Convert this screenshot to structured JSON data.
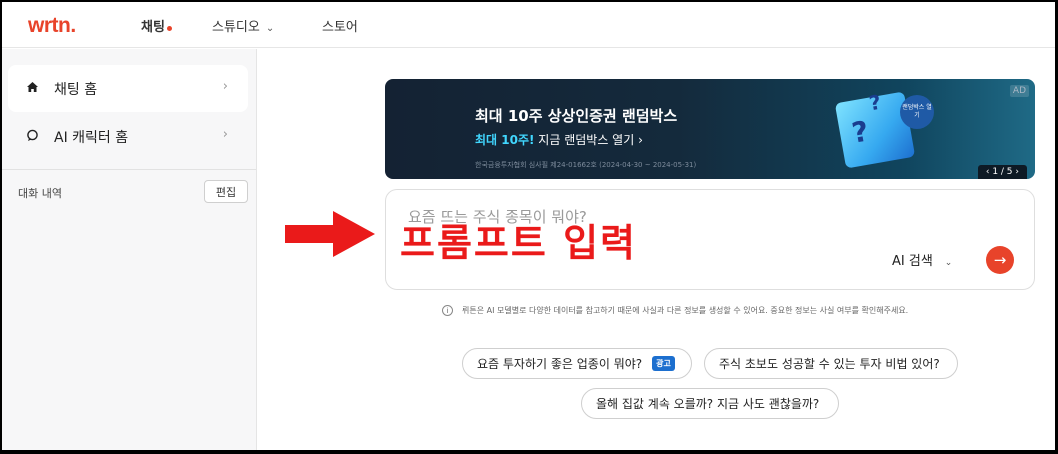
{
  "header": {
    "logo": "wrtn.",
    "nav": [
      {
        "label": "채팅"
      },
      {
        "label": "스튜디오"
      },
      {
        "label": "스토어"
      }
    ]
  },
  "sidebar": {
    "items": [
      {
        "label": "채팅 홈",
        "icon": "home-icon"
      },
      {
        "label": "AI 캐릭터 홈",
        "icon": "chat-bubble-icon"
      }
    ],
    "history_label": "대화 내역",
    "edit_label": "편집"
  },
  "ad_banner": {
    "title": "최대 10주 상상인증권 랜덤박스",
    "sub_highlight": "최대 10주!",
    "sub_rest": " 지금 랜덤박스 열기 ›",
    "fine_print": "한국금융투자협회 심사필 제24-01662호 (2024-04-30 ~ 2024-05-31)",
    "badge": "AD",
    "bubble": "랜덤박스 열기",
    "pager": "‹ 1 / 5 ›"
  },
  "prompt": {
    "placeholder": "요즘 뜨는 주식 종목이 뭐야?",
    "value": "",
    "search_mode": "AI 검색"
  },
  "overlay": {
    "annotation": "프롬프트 입력",
    "arrow_color": "#ea1a1a"
  },
  "notice": "뤼튼은 AI 모델별로 다양한 데이터를 참고하기 때문에 사실과 다른 정보를 생성할 수 있어요. 중요한 정보는 사실 여부를 확인해주세요.",
  "suggestions": [
    {
      "label": "요즘 투자하기 좋은 업종이 뭐야?",
      "tag": "광고"
    },
    {
      "label": "주식 초보도 성공할 수 있는 투자 비법 있어?"
    },
    {
      "label": "올해 집값 계속 오를까? 지금 사도 괜찮을까?"
    }
  ],
  "colors": {
    "brand": "#e8432a",
    "ad_tag": "#1c6fcf"
  }
}
